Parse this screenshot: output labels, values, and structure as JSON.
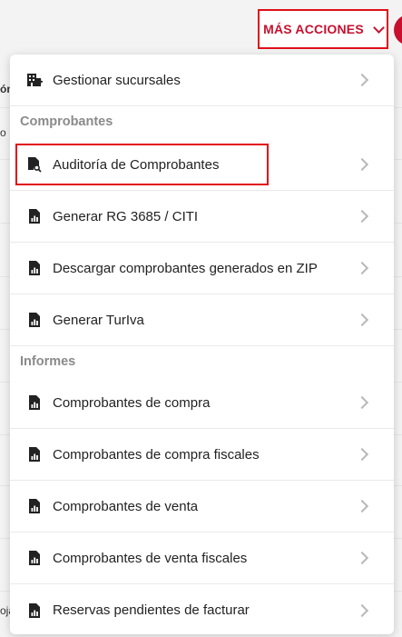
{
  "header": {
    "more_actions_label": "MÁS ACCIONES",
    "chevron_icon": "chevron-down-icon",
    "accent_color": "#c8102e"
  },
  "background": {
    "frag1": "ón",
    "frag2": "o",
    "frag3": "oja"
  },
  "menu": {
    "top_item": {
      "label": "Gestionar sucursales",
      "icon": "building-add-icon"
    },
    "sections": [
      {
        "title": "Comprobantes",
        "items": [
          {
            "label": "Auditoría de Comprobantes",
            "icon": "document-search-icon"
          },
          {
            "label": "Generar RG 3685 / CITI",
            "icon": "report-document-icon"
          },
          {
            "label": "Descargar comprobantes generados en ZIP",
            "icon": "report-document-icon"
          },
          {
            "label": "Generar TurIva",
            "icon": "report-document-icon"
          }
        ]
      },
      {
        "title": "Informes",
        "items": [
          {
            "label": "Comprobantes de compra",
            "icon": "report-document-icon"
          },
          {
            "label": "Comprobantes de compra fiscales",
            "icon": "report-document-icon"
          },
          {
            "label": "Comprobantes de venta",
            "icon": "report-document-icon"
          },
          {
            "label": "Comprobantes de venta fiscales",
            "icon": "report-document-icon"
          },
          {
            "label": "Reservas pendientes de facturar",
            "icon": "report-document-icon"
          }
        ]
      }
    ],
    "chevron_icon": "chevron-right-icon"
  }
}
